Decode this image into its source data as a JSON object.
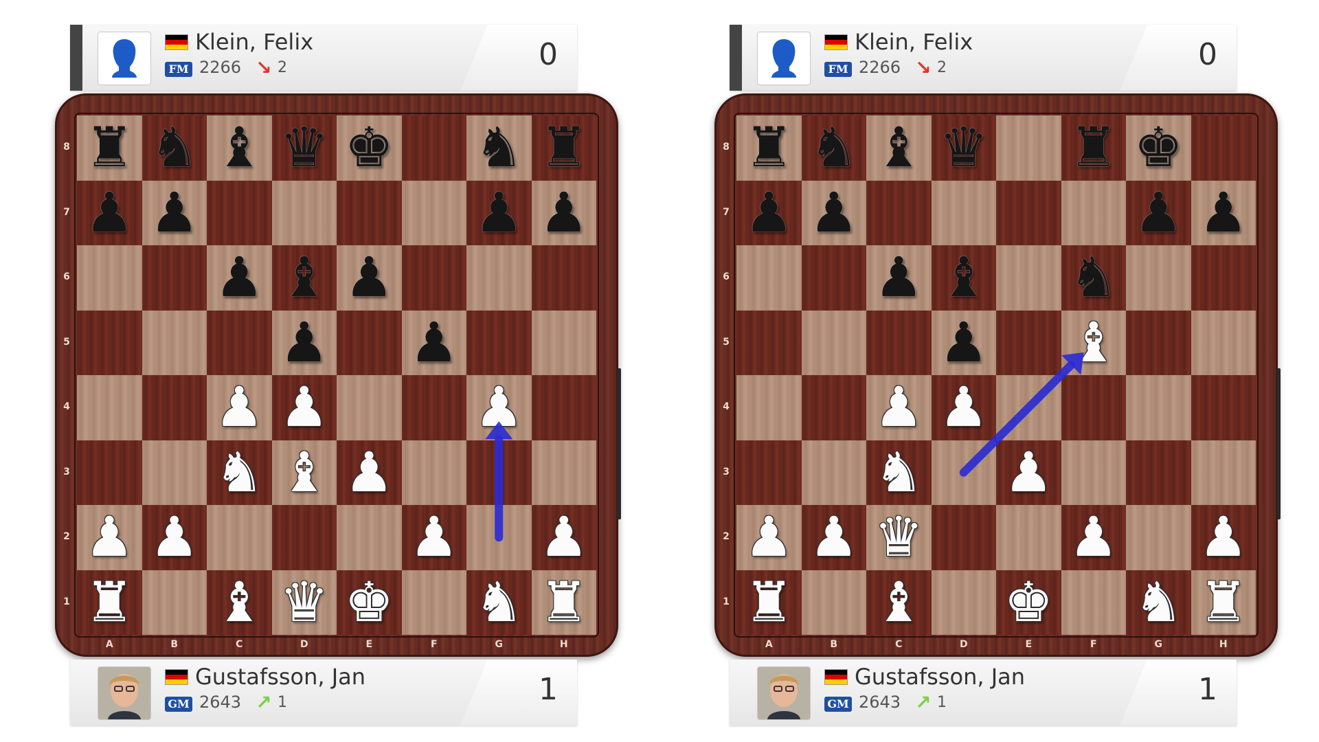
{
  "colors": {
    "arrow": "#2a2bd6",
    "trend_down": "#d93a2b",
    "trend_up": "#7ccf4c",
    "title_badge": "#1f4fa5",
    "flag": [
      "#000000",
      "#dd0000",
      "#ffce00"
    ]
  },
  "files": [
    "A",
    "B",
    "C",
    "D",
    "E",
    "F",
    "G",
    "H"
  ],
  "ranks": [
    "8",
    "7",
    "6",
    "5",
    "4",
    "3",
    "2",
    "1"
  ],
  "panels": [
    {
      "top_player": {
        "name": "Klein, Felix",
        "title": "FM",
        "rating": "2266",
        "trend": "down",
        "trend_arrow": "↘",
        "trend_value": "2",
        "score": "0",
        "avatar": "silhouette-avatar"
      },
      "bottom_player": {
        "name": "Gustafsson, Jan",
        "title": "GM",
        "rating": "2643",
        "trend": "up",
        "trend_arrow": "↗",
        "trend_value": "1",
        "score": "1",
        "avatar": "photo-avatar"
      },
      "board": [
        [
          "r",
          "n",
          "b",
          "q",
          "k",
          "",
          "n",
          "r"
        ],
        [
          "p",
          "p",
          "",
          "",
          "",
          "",
          "p",
          "p"
        ],
        [
          "",
          "",
          "p",
          "b",
          "p",
          "",
          "",
          ""
        ],
        [
          "",
          "",
          "",
          "p",
          "",
          "p",
          "",
          ""
        ],
        [
          "",
          "",
          "P",
          "P",
          "",
          "",
          "P",
          ""
        ],
        [
          "",
          "",
          "N",
          "B",
          "P",
          "",
          "",
          ""
        ],
        [
          "P",
          "P",
          "",
          "",
          "",
          "P",
          "",
          "P"
        ],
        [
          "R",
          "",
          "B",
          "Q",
          "K",
          "",
          "N",
          "R"
        ]
      ],
      "arrow": {
        "from": "g2",
        "to": "g4"
      }
    },
    {
      "top_player": {
        "name": "Klein, Felix",
        "title": "FM",
        "rating": "2266",
        "trend": "down",
        "trend_arrow": "↘",
        "trend_value": "2",
        "score": "0",
        "avatar": "silhouette-avatar"
      },
      "bottom_player": {
        "name": "Gustafsson, Jan",
        "title": "GM",
        "rating": "2643",
        "trend": "up",
        "trend_arrow": "↗",
        "trend_value": "1",
        "score": "1",
        "avatar": "photo-avatar"
      },
      "board": [
        [
          "r",
          "n",
          "b",
          "q",
          "",
          "r",
          "k",
          ""
        ],
        [
          "p",
          "p",
          "",
          "",
          "",
          "",
          "p",
          "p"
        ],
        [
          "",
          "",
          "p",
          "b",
          "",
          "n",
          "",
          ""
        ],
        [
          "",
          "",
          "",
          "p",
          "",
          "B",
          "",
          ""
        ],
        [
          "",
          "",
          "P",
          "P",
          "",
          "",
          "",
          ""
        ],
        [
          "",
          "",
          "N",
          "",
          "P",
          "",
          "",
          ""
        ],
        [
          "P",
          "P",
          "Q",
          "",
          "",
          "P",
          "",
          "P"
        ],
        [
          "R",
          "",
          "B",
          "",
          "K",
          "",
          "N",
          "R"
        ]
      ],
      "arrow": {
        "from": "d3",
        "to": "f5"
      }
    }
  ]
}
